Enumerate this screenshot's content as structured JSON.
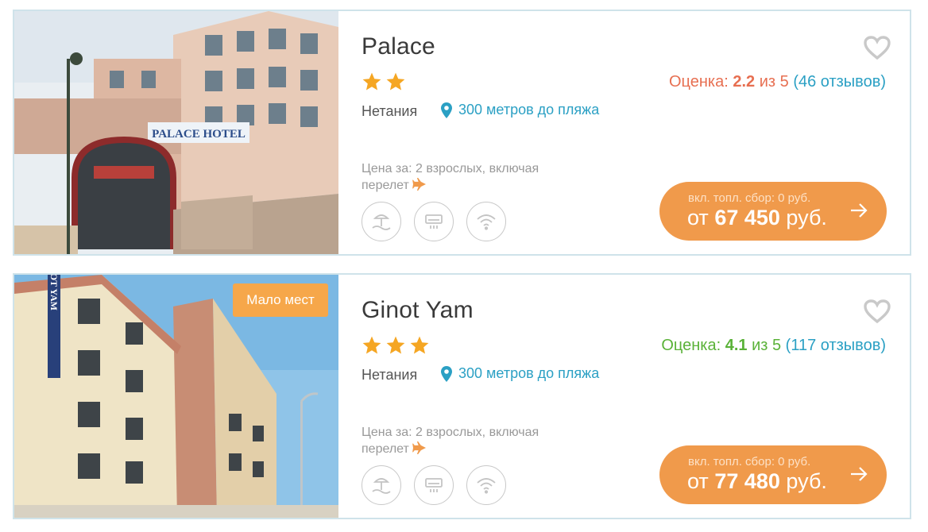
{
  "hotels": [
    {
      "name": "Palace",
      "stars": 2,
      "rating": {
        "label": "Оценка:",
        "score": "2.2",
        "of": "из 5",
        "open": "(",
        "reviews": "46 отзывов",
        "close": ")"
      },
      "city": "Нетания",
      "distance": "300 метров до пляжа",
      "price_for": "Цена за: 2 взрослых, включая перелет",
      "fee": "вкл. топл. сбор: 0 руб.",
      "price_prefix": "от",
      "price_amount": "67 450",
      "price_currency": "руб.",
      "photo_sign": "PALACE HOTEL",
      "amenities": [
        "beach-icon",
        "air-conditioner-icon",
        "wifi-icon"
      ],
      "rating_color": "#e76f51"
    },
    {
      "name": "Ginot Yam",
      "stars": 3,
      "badge": "Мало мест",
      "rating": {
        "label": "Оценка:",
        "score": "4.1",
        "of": "из 5",
        "open": "(",
        "reviews": "117 отзывов",
        "close": ")"
      },
      "city": "Нетания",
      "distance": "300 метров до пляжа",
      "price_for": "Цена за: 2 взрослых, включая перелет",
      "fee": "вкл. топл. сбор: 0 руб.",
      "price_prefix": "от",
      "price_amount": "77 480",
      "price_currency": "руб.",
      "photo_sign": "GINOT YAM",
      "amenities": [
        "beach-icon",
        "air-conditioner-icon",
        "wifi-icon"
      ],
      "rating_color": "#5ab238"
    }
  ],
  "colors": {
    "accent": "#f09a4b",
    "link": "#2ba0c4",
    "star": "#f5a623",
    "border": "#cfe3ea"
  }
}
